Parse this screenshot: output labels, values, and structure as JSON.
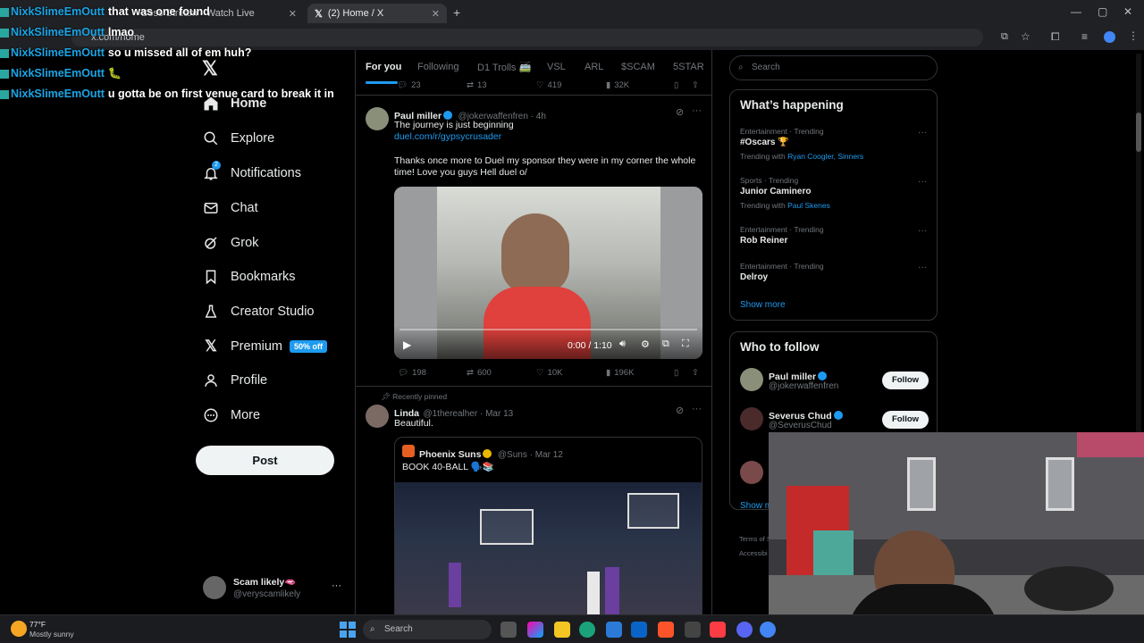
{
  "browser": {
    "tabs": [
      {
        "label": "Boss Stream - Watch Live"
      },
      {
        "label": "(2) Home / X"
      }
    ],
    "url": "x.com/home"
  },
  "chat": [
    {
      "user": "NixkSlimeEmOutt",
      "message": "that was one found"
    },
    {
      "user": "NixkSlimeEmOutt",
      "message": "lmao"
    },
    {
      "user": "NixkSlimeEmOutt",
      "message": "so u missed all of em huh?"
    },
    {
      "user": "NixkSlimeEmOutt",
      "message": "🐛"
    },
    {
      "user": "NixkSlimeEmOutt",
      "message": "u gotta be on first venue card to break it in"
    }
  ],
  "nav": {
    "items": [
      {
        "label": "Home",
        "icon": "home-icon"
      },
      {
        "label": "Explore",
        "icon": "search-icon"
      },
      {
        "label": "Notifications",
        "icon": "bell-icon",
        "badge": "2"
      },
      {
        "label": "Chat",
        "icon": "mail-icon"
      },
      {
        "label": "Grok",
        "icon": "grok-icon"
      },
      {
        "label": "Bookmarks",
        "icon": "bookmark-icon"
      },
      {
        "label": "Creator Studio",
        "icon": "flask-icon"
      },
      {
        "label": "Premium",
        "icon": "x-logo-icon",
        "badge": "50% off"
      },
      {
        "label": "Profile",
        "icon": "person-icon"
      },
      {
        "label": "More",
        "icon": "more-circle-icon"
      }
    ],
    "post_label": "Post",
    "account": {
      "name": "Scam likely",
      "emoji": "🫦",
      "handle": "@veryscamlikely"
    }
  },
  "feed": {
    "tabs": [
      "For you",
      "Following",
      "D1 Trolls 🚎",
      "VSL",
      "ARL",
      "$SCAM",
      "5STAR"
    ],
    "prev_actions": {
      "replies": "23",
      "reposts": "13",
      "likes": "419",
      "views": "32K"
    },
    "tweets": [
      {
        "name": "Paul miller",
        "handle": "@jokerwaffenfren",
        "time": "4h",
        "line1": "The journey is just beginning",
        "link": "duel.com/r/gypsycrusader",
        "line2": "Thanks once more to Duel my sponsor they were in my corner the whole time! Love you guys Hell duel o/",
        "video_time": "0:00 / 1:10",
        "replies": "198",
        "reposts": "600",
        "likes": "10K",
        "views": "196K"
      },
      {
        "pinned_label": "Recently pinned",
        "name": "Linda",
        "handle": "@1therealher",
        "time": "Mar 13",
        "text": "Beautiful.",
        "quote": {
          "name": "Phoenix Suns",
          "handle": "@Suns",
          "time": "Mar 12",
          "text": "BOOK 40-BALL 🗣️📚"
        }
      }
    ]
  },
  "sidebar": {
    "search_placeholder": "Search",
    "trending_title": "What’s happening",
    "trends": [
      {
        "meta": "Entertainment · Trending",
        "name": "#Oscars 🏆",
        "with_label": "Trending with",
        "with": "Ryan Coogler, Sinners"
      },
      {
        "meta": "Sports · Trending",
        "name": "Junior Caminero",
        "with_label": "Trending with",
        "with": "Paul Skenes"
      },
      {
        "meta": "Entertainment · Trending",
        "name": "Rob Reiner"
      },
      {
        "meta": "Entertainment · Trending",
        "name": "Delroy"
      }
    ],
    "show_more": "Show more",
    "follow_title": "Who to follow",
    "follow": [
      {
        "name": "Paul miller",
        "handle": "@jokerwaffenfren",
        "button": "Follow"
      },
      {
        "name": "Severus Chud",
        "handle": "@SeverusChud",
        "button": "Follow"
      }
    ],
    "show_more_2": "Show m",
    "terms": "Terms of S",
    "accessibility": "Accessibi"
  },
  "taskbar": {
    "temp": "77°F",
    "weather": "Mostly sunny",
    "search": "Search"
  },
  "colors": {
    "accent": "#1d9bf0",
    "bg": "#000000",
    "border": "#2f3336",
    "muted": "#71767b"
  }
}
